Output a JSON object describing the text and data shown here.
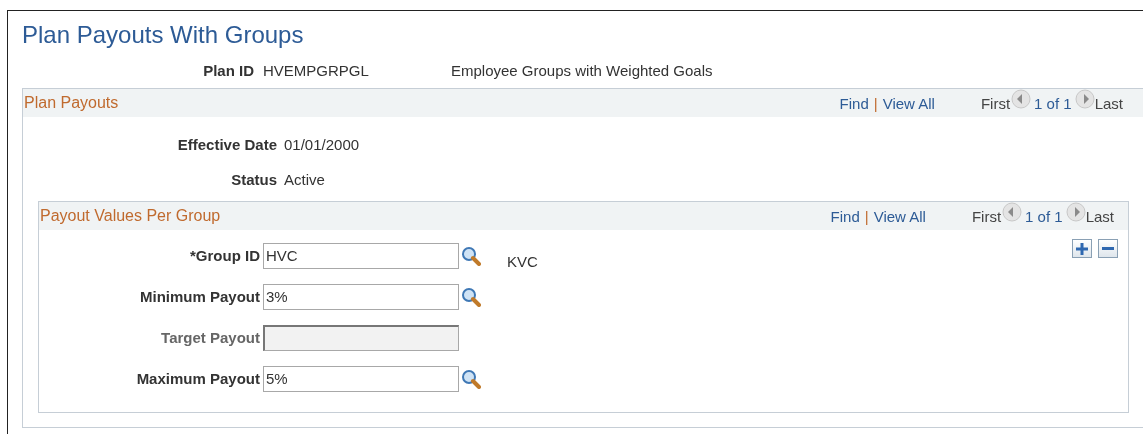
{
  "page": {
    "title": "Plan Payouts With Groups"
  },
  "plan": {
    "label": "Plan ID",
    "value": "HVEMPGRPGL",
    "description": "Employee Groups with Weighted Goals"
  },
  "plan_payouts": {
    "title": "Plan Payouts",
    "nav": {
      "find": "Find",
      "separator": "|",
      "view_all": "View All",
      "first": "First",
      "count": "1 of 1",
      "last": "Last"
    },
    "fields": [
      {
        "label": "Effective Date",
        "value": "01/01/2000"
      },
      {
        "label": "Status",
        "value": "Active"
      }
    ],
    "payout_values": {
      "title": "Payout Values Per Group",
      "nav": {
        "find": "Find",
        "separator": "|",
        "view_all": "View All",
        "first": "First",
        "count": "1 of 1",
        "last": "Last"
      },
      "fields": [
        {
          "label": "*Group ID",
          "value": "HVC",
          "disabled": false,
          "lookup": true,
          "description": "KVC"
        },
        {
          "label": "Minimum Payout",
          "value": "3%",
          "disabled": false,
          "lookup": true
        },
        {
          "label": "Target Payout",
          "disabled": true,
          "lookup": false
        },
        {
          "label": "Maximum Payout",
          "value": "5%",
          "disabled": false,
          "lookup": true
        }
      ]
    }
  }
}
